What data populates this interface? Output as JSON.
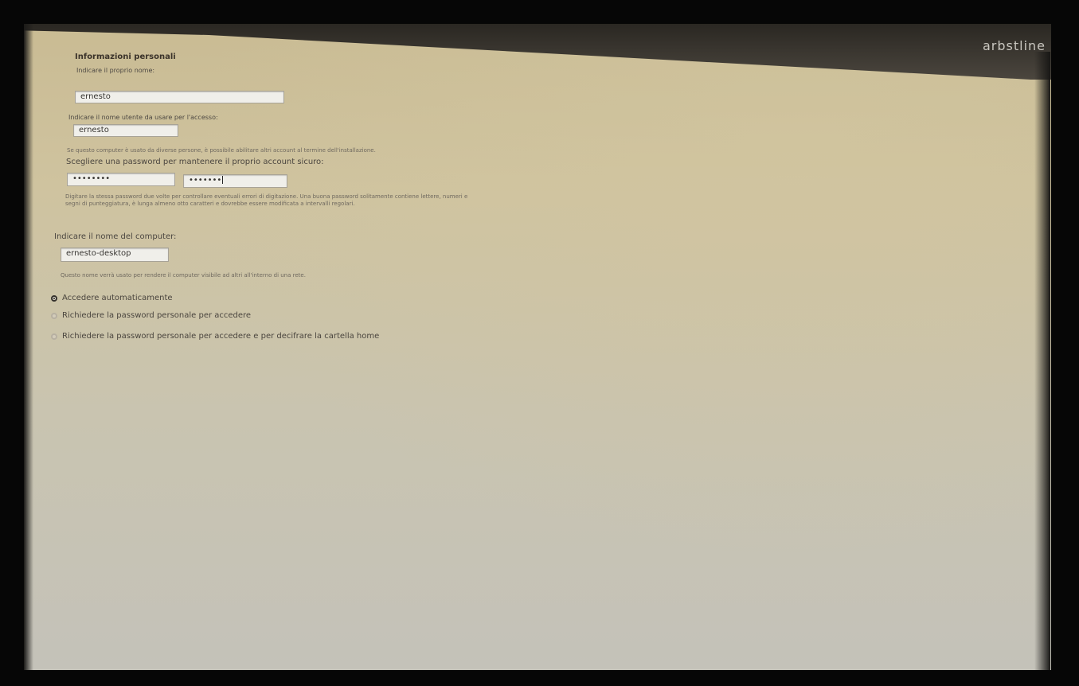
{
  "brand": "arbstline",
  "section_title": "Informazioni personali",
  "name": {
    "label": "Indicare il proprio nome:",
    "value": "ernesto"
  },
  "username": {
    "label": "Indicare il nome utente da usare per l'accesso:",
    "value": "ernesto",
    "help": "Se questo computer è usato da diverse persone, è possibile abilitare altri account al termine dell'installazione."
  },
  "password": {
    "label": "Scegliere una password per mantenere il proprio account sicuro:",
    "value": "••••••••",
    "confirm_value": "•••••••",
    "help": "Digitare la stessa password due volte per controllare eventuali errori di digitazione. Una buona password solitamente contiene lettere, numeri e segni di punteggiatura, è lunga almeno otto caratteri e dovrebbe essere modificata a intervalli regolari."
  },
  "computer": {
    "label": "Indicare il nome del computer:",
    "value": "ernesto-desktop",
    "help": "Questo nome verrà usato per rendere il computer visibile ad altri all'interno di una rete."
  },
  "login_options": [
    {
      "label": "Accedere automaticamente",
      "selected": true
    },
    {
      "label": "Richiedere la password personale per accedere",
      "selected": false
    },
    {
      "label": "Richiedere la password personale per accedere e per decifrare la cartella home",
      "selected": false
    }
  ]
}
